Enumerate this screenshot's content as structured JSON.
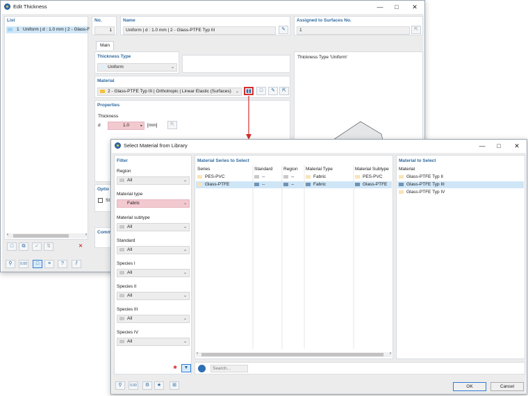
{
  "edit_window": {
    "title": "Edit Thickness",
    "list_label": "List",
    "list_items": [
      {
        "num": "1",
        "text": "Uniform | d : 1.0 mm | 2 - Glass-F"
      }
    ],
    "no_label": "No.",
    "no_value": "1",
    "name_label": "Name",
    "name_value": "Uniform | d : 1.0 mm | 2 - Glass-PTFE Typ III",
    "assigned_label": "Assigned to Surfaces No.",
    "assigned_value": "1",
    "tab_main": "Main",
    "thickness_type_label": "Thickness Type",
    "thickness_type_value": "Uniform",
    "material_label": "Material",
    "material_value": "2 - Glass-PTFE Typ III | Orthotropic | Linear Elastic (Surfaces)",
    "properties_label": "Properties",
    "thickness_label": "Thickness",
    "d_label": "d",
    "d_value": "1.0",
    "d_unit": "[mm]",
    "options_label": "Optio",
    "options_checkbox_label": "St",
    "comment_label": "Comm",
    "preview_title": "Thickness Type  'Uniform'"
  },
  "library_window": {
    "title": "Select Material from Library",
    "filter_label": "Filter",
    "filters": [
      {
        "label": "Region",
        "value": "All"
      },
      {
        "label": "Material type",
        "value": "Fabric"
      },
      {
        "label": "Material subtype",
        "value": "All"
      },
      {
        "label": "Standard",
        "value": "All"
      },
      {
        "label": "Species I",
        "value": "All"
      },
      {
        "label": "Species II",
        "value": "All"
      },
      {
        "label": "Species III",
        "value": "All"
      },
      {
        "label": "Species IV",
        "value": "All"
      }
    ],
    "series_panel_title": "Material Series to Select",
    "series_headers": [
      "Series",
      "Standard",
      "Region",
      "Material Type",
      "Material Subtype"
    ],
    "series_rows": [
      {
        "series": "PES-PVC",
        "standard": "--",
        "region": "--",
        "material_type": "Fabric",
        "subtype": "PES-PVC"
      },
      {
        "series": "Glass-PTFE",
        "standard": "--",
        "region": "--",
        "material_type": "Fabric",
        "subtype": "Glass-PTFE"
      }
    ],
    "select_panel_title": "Material to Select",
    "material_header": "Material",
    "materials": [
      "Glass-PTFE Typ II",
      "Glass-PTFE Typ III",
      "Glass-PTFE Typ IV"
    ],
    "search_placeholder": "Search...",
    "ok_label": "OK",
    "cancel_label": "Cancel"
  },
  "colors": {
    "accent_blue": "#2f6aa0",
    "selection": "#cfe6f7",
    "highlight_red": "#d32f2f",
    "material_swatch": "#f3c23a",
    "fabric_swatch": "#f7e3b5",
    "pink_field": "#f3c9d0"
  }
}
